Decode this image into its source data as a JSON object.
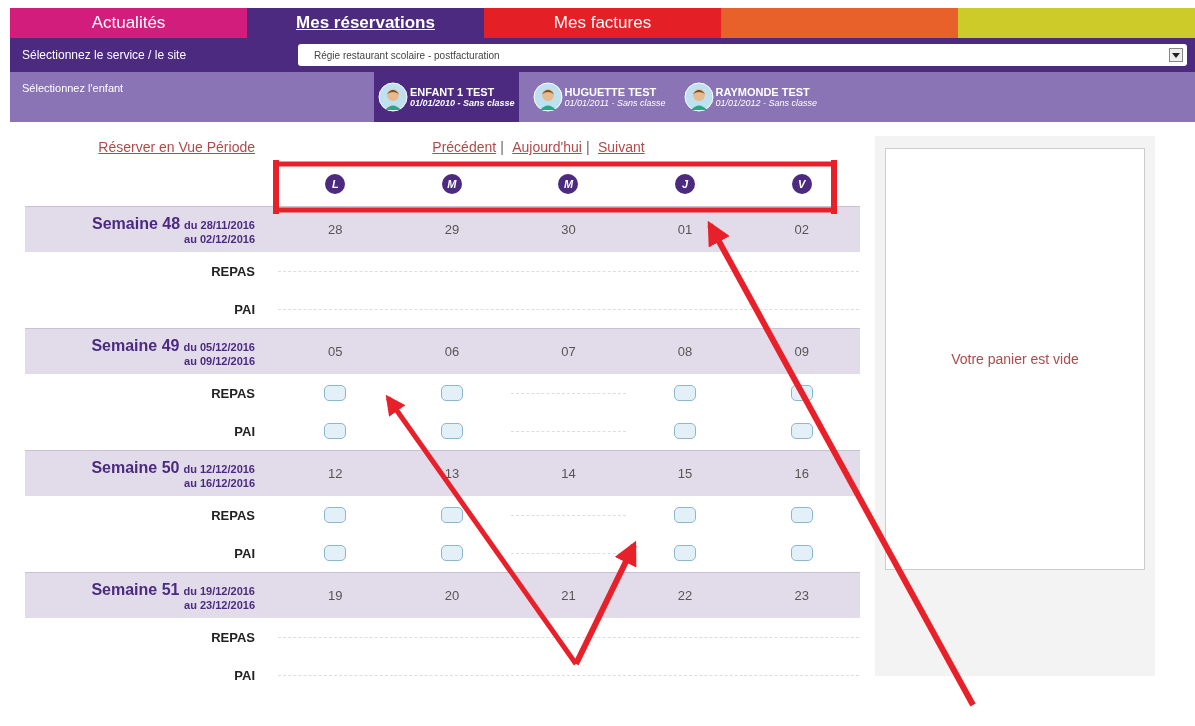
{
  "tabs": [
    {
      "label": "Actualités",
      "selected": false,
      "color": "#d21d7c"
    },
    {
      "label": "Mes réservations",
      "selected": true,
      "color": "#4b2a80"
    },
    {
      "label": "Mes factures",
      "selected": false,
      "color": "#e41f26"
    }
  ],
  "color_blocks": [
    {
      "color": "#e8612a"
    },
    {
      "color": "#cccb2a"
    }
  ],
  "service": {
    "label": "Sélectionnez le service / le site",
    "value": "Régie restaurant scolaire - postfacturation"
  },
  "children_bar": {
    "label": "Sélectionnez l'enfant",
    "children": [
      {
        "name": "ENFANT 1 TEST",
        "info": "01/01/2010 - Sans classe",
        "selected": true
      },
      {
        "name": "HUGUETTE TEST",
        "info": "01/01/2011 - Sans classe",
        "selected": false
      },
      {
        "name": "RAYMONDE TEST",
        "info": "01/01/2012 - Sans classe",
        "selected": false
      }
    ]
  },
  "period_link": "Réserver en Vue Période",
  "nav": [
    "Précédent",
    "Aujourd'hui",
    "Suivant"
  ],
  "nav_separator": "|",
  "days": [
    "L",
    "M",
    "M",
    "J",
    "V"
  ],
  "weeks": [
    {
      "title": "Semaine 48",
      "from": "du 28/11/2016",
      "to": "au 02/12/2016",
      "dates": [
        "28",
        "29",
        "30",
        "01",
        "02"
      ],
      "rows": [
        {
          "label": "REPAS",
          "cells": [
            {
              "kind": "none"
            },
            {
              "kind": "none"
            },
            {
              "kind": "none"
            },
            {
              "kind": "none"
            },
            {
              "kind": "none"
            }
          ]
        },
        {
          "label": "PAI",
          "cells": [
            {
              "kind": "none"
            },
            {
              "kind": "none"
            },
            {
              "kind": "none"
            },
            {
              "kind": "none"
            },
            {
              "kind": "none"
            }
          ]
        }
      ]
    },
    {
      "title": "Semaine 49",
      "from": "du 05/12/2016",
      "to": "au 09/12/2016",
      "dates": [
        "05",
        "06",
        "07",
        "08",
        "09"
      ],
      "rows": [
        {
          "label": "REPAS",
          "cells": [
            {
              "kind": "checkbox",
              "checked": false
            },
            {
              "kind": "checkbox",
              "checked": false
            },
            {
              "kind": "none"
            },
            {
              "kind": "checkbox",
              "checked": false
            },
            {
              "kind": "checkbox",
              "checked": false
            }
          ]
        },
        {
          "label": "PAI",
          "cells": [
            {
              "kind": "checkbox",
              "checked": false
            },
            {
              "kind": "checkbox",
              "checked": false
            },
            {
              "kind": "none"
            },
            {
              "kind": "checkbox",
              "checked": false
            },
            {
              "kind": "checkbox",
              "checked": false
            }
          ]
        }
      ]
    },
    {
      "title": "Semaine 50",
      "from": "du 12/12/2016",
      "to": "au 16/12/2016",
      "dates": [
        "12",
        "13",
        "14",
        "15",
        "16"
      ],
      "rows": [
        {
          "label": "REPAS",
          "cells": [
            {
              "kind": "checkbox",
              "checked": false
            },
            {
              "kind": "checkbox",
              "checked": false
            },
            {
              "kind": "none"
            },
            {
              "kind": "checkbox",
              "checked": false
            },
            {
              "kind": "checkbox",
              "checked": false
            }
          ]
        },
        {
          "label": "PAI",
          "cells": [
            {
              "kind": "checkbox",
              "checked": false
            },
            {
              "kind": "checkbox",
              "checked": false
            },
            {
              "kind": "none"
            },
            {
              "kind": "checkbox",
              "checked": false
            },
            {
              "kind": "checkbox",
              "checked": false
            }
          ]
        }
      ]
    },
    {
      "title": "Semaine 51",
      "from": "du 19/12/2016",
      "to": "au 23/12/2016",
      "dates": [
        "19",
        "20",
        "21",
        "22",
        "23"
      ],
      "rows": [
        {
          "label": "REPAS",
          "cells": [
            {
              "kind": "none"
            },
            {
              "kind": "none"
            },
            {
              "kind": "none"
            },
            {
              "kind": "none"
            },
            {
              "kind": "none"
            }
          ]
        },
        {
          "label": "PAI",
          "cells": [
            {
              "kind": "none"
            },
            {
              "kind": "none"
            },
            {
              "kind": "none"
            },
            {
              "kind": "none"
            },
            {
              "kind": "none"
            }
          ]
        }
      ]
    }
  ],
  "cart": {
    "message": "Votre panier est vide"
  }
}
